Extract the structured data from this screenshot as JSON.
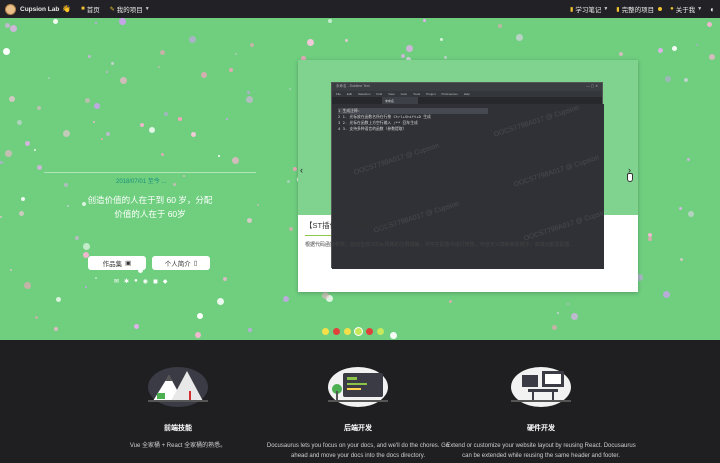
{
  "nav": {
    "brand": "Cupsion Lab",
    "brand_icon": "👋",
    "home": "首页",
    "home_icon": "home-icon",
    "projects": "我的项目",
    "study": "学习笔记",
    "complete_projects": "完整的项目",
    "about": "关于我",
    "theme_icon": "moon-icon"
  },
  "hero": {
    "date": "2018/07/01 至今 ...",
    "slogan_line1": "创造价值的人在于到 60 岁，分配",
    "slogan_line2": "价值的人在于 60岁",
    "works_button": "作品集",
    "intro_button": "个人简介",
    "social_icons": [
      "mail-icon",
      "link-icon",
      "github-icon",
      "wechat-icon",
      "chat-icon",
      "qq-icon"
    ]
  },
  "carousel": {
    "caption": "【ST插件】生成函数注释",
    "description": "根据代码函数参数，自动生成JSDoc风格的注释模板，并可在配置中进行修改，可自定义模板和关键字，高级功能需配置。",
    "editor_title": "未命名 - Sublime Text",
    "editor_menu": [
      "File",
      "Edit",
      "Selection",
      "Find",
      "View",
      "Goto",
      "Tools",
      "Project",
      "Preferences",
      "Help"
    ],
    "editor_tab": "未命名",
    "editor_lines": [
      "1   生成注释:",
      "2   1. 光标放在函数名所在行按 Ctrl+Shift+D 生成",
      "3   2. 光标在函数上方空行输入 /** 回车生成",
      "4   3. 支持多种语言的函数（参数提取）"
    ],
    "watermark": "OOCS7798A017 @ Cupsion",
    "dot_colors": [
      "#f5e04a",
      "#e0413a",
      "#f5e04a",
      "#c7e85a",
      "#e0413a",
      "#c7e85a"
    ],
    "active_dot": 3
  },
  "features": [
    {
      "title": "前端技能",
      "text": "Vue 全家桶 + React 全家桶的熟悉。"
    },
    {
      "title": "后端开发",
      "text": "Docusaurus lets you focus on your docs, and we'll do the chores. Go ahead and move your docs into the docs directory."
    },
    {
      "title": "硬件开发",
      "text": "Extend or customize your website layout by reusing React. Docusaurus can be extended while reusing the same header and footer."
    }
  ],
  "colors": {
    "hero_bg": "#6fcf7f",
    "nav_bg": "#222226",
    "footer_bg": "#1f1f22",
    "accent": "#f1c232"
  }
}
